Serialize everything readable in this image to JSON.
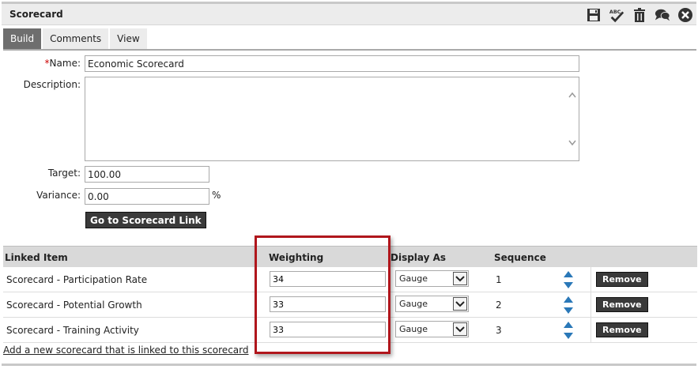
{
  "panel": {
    "title": "Scorecard"
  },
  "toolbar": {
    "icons": [
      "save-icon",
      "spellcheck-icon",
      "trash-icon",
      "comments-icon",
      "close-icon"
    ],
    "spellcheck_text": "ABC"
  },
  "tabs": [
    {
      "label": "Build",
      "active": true
    },
    {
      "label": "Comments",
      "active": false
    },
    {
      "label": "View",
      "active": false
    }
  ],
  "form": {
    "name_required_mark": "*",
    "name_label": "Name:",
    "name_value": "Economic Scorecard",
    "description_label": "Description:",
    "description_value": "",
    "target_label": "Target:",
    "target_value": "100.00",
    "variance_label": "Variance:",
    "variance_value": "0.00",
    "variance_unit": "%",
    "go_button": "Go to Scorecard Link"
  },
  "grid": {
    "headers": {
      "linked_item": "Linked Item",
      "weighting": "Weighting",
      "display_as": "Display As",
      "sequence": "Sequence"
    },
    "rows": [
      {
        "item": "Scorecard - Participation Rate",
        "weighting": "34",
        "display": "Gauge",
        "sequence": "1",
        "remove": "Remove"
      },
      {
        "item": "Scorecard - Potential Growth",
        "weighting": "33",
        "display": "Gauge",
        "sequence": "2",
        "remove": "Remove"
      },
      {
        "item": "Scorecard - Training Activity",
        "weighting": "33",
        "display": "Gauge",
        "sequence": "3",
        "remove": "Remove"
      }
    ]
  },
  "add_link": "Add a new scorecard that is linked to this scorecard",
  "colors": {
    "highlight": "#b0161c",
    "arrow": "#2a78b8",
    "active_tab": "#6e6e6e"
  }
}
